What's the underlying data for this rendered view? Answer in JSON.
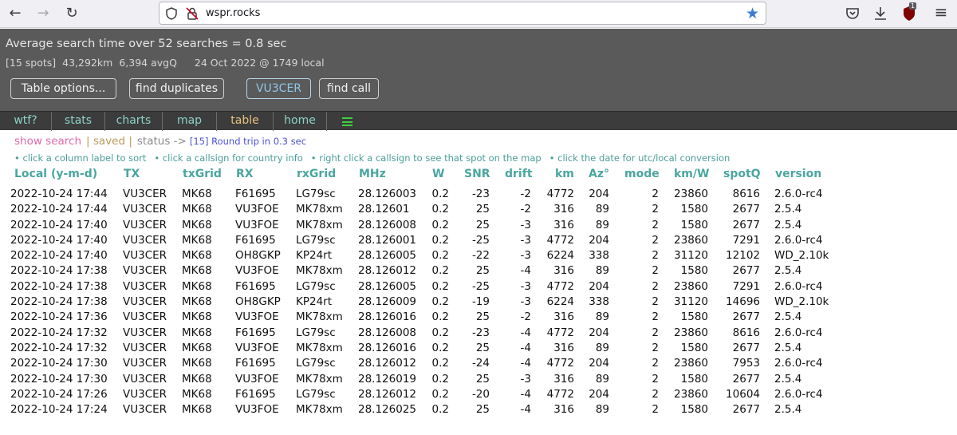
{
  "browser": {
    "url": "wspr.rocks",
    "badge_count": "1"
  },
  "header": {
    "avg_line": "Average search time over 52 searches = 0.8 sec",
    "spots": "[15 spots]",
    "distance": "43,292km",
    "avgq": "6,394 avgQ",
    "datetime": "24 Oct 2022 @ 1749 local"
  },
  "buttons": {
    "table_options": "Table options...",
    "find_duplicates": "find duplicates",
    "callsign": "VU3CER",
    "find_call": "find call"
  },
  "nav": {
    "wtf": "wtf?",
    "stats": "stats",
    "charts": "charts",
    "map": "map",
    "table": "table",
    "home": "home"
  },
  "status": {
    "show_search": "show search",
    "saved": "| saved |",
    "status": "status ->",
    "round_trip": "[15] Round trip in 0.3 sec"
  },
  "hints": [
    "• click a column label to sort",
    "• click a callsign for country info",
    "• right click a callsign to see that spot on the map",
    "• click the date for utc/local conversion"
  ],
  "columns": [
    "Local   (y-m-d)",
    "TX",
    "txGrid",
    "RX",
    "rxGrid",
    "MHz",
    "W",
    "SNR",
    "drift",
    "km",
    "Az°",
    "mode",
    "km/W",
    "spotQ",
    "version"
  ],
  "rows": [
    [
      "2022-10-24 17:44",
      "VU3CER",
      "MK68",
      "F61695",
      "LG79sc",
      "28.126003",
      "0.2",
      "-23",
      "-2",
      "4772",
      "204",
      "2",
      "23860",
      "8616",
      "2.6.0-rc4"
    ],
    [
      "2022-10-24 17:44",
      "VU3CER",
      "MK68",
      "VU3FOE",
      "MK78xm",
      "28.12601",
      "0.2",
      "25",
      "-2",
      "316",
      "89",
      "2",
      "1580",
      "2677",
      "2.5.4"
    ],
    [
      "2022-10-24 17:40",
      "VU3CER",
      "MK68",
      "VU3FOE",
      "MK78xm",
      "28.126008",
      "0.2",
      "25",
      "-3",
      "316",
      "89",
      "2",
      "1580",
      "2677",
      "2.5.4"
    ],
    [
      "2022-10-24 17:40",
      "VU3CER",
      "MK68",
      "F61695",
      "LG79sc",
      "28.126001",
      "0.2",
      "-25",
      "-3",
      "4772",
      "204",
      "2",
      "23860",
      "7291",
      "2.6.0-rc4"
    ],
    [
      "2022-10-24 17:40",
      "VU3CER",
      "MK68",
      "OH8GKP",
      "KP24rt",
      "28.126005",
      "0.2",
      "-22",
      "-3",
      "6224",
      "338",
      "2",
      "31120",
      "12102",
      "WD_2.10k"
    ],
    [
      "2022-10-24 17:38",
      "VU3CER",
      "MK68",
      "VU3FOE",
      "MK78xm",
      "28.126012",
      "0.2",
      "25",
      "-4",
      "316",
      "89",
      "2",
      "1580",
      "2677",
      "2.5.4"
    ],
    [
      "2022-10-24 17:38",
      "VU3CER",
      "MK68",
      "F61695",
      "LG79sc",
      "28.126005",
      "0.2",
      "-25",
      "-3",
      "4772",
      "204",
      "2",
      "23860",
      "7291",
      "2.6.0-rc4"
    ],
    [
      "2022-10-24 17:38",
      "VU3CER",
      "MK68",
      "OH8GKP",
      "KP24rt",
      "28.126009",
      "0.2",
      "-19",
      "-3",
      "6224",
      "338",
      "2",
      "31120",
      "14696",
      "WD_2.10k"
    ],
    [
      "2022-10-24 17:36",
      "VU3CER",
      "MK68",
      "VU3FOE",
      "MK78xm",
      "28.126016",
      "0.2",
      "25",
      "-2",
      "316",
      "89",
      "2",
      "1580",
      "2677",
      "2.5.4"
    ],
    [
      "2022-10-24 17:32",
      "VU3CER",
      "MK68",
      "F61695",
      "LG79sc",
      "28.126008",
      "0.2",
      "-23",
      "-4",
      "4772",
      "204",
      "2",
      "23860",
      "8616",
      "2.6.0-rc4"
    ],
    [
      "2022-10-24 17:32",
      "VU3CER",
      "MK68",
      "VU3FOE",
      "MK78xm",
      "28.126016",
      "0.2",
      "25",
      "-4",
      "316",
      "89",
      "2",
      "1580",
      "2677",
      "2.5.4"
    ],
    [
      "2022-10-24 17:30",
      "VU3CER",
      "MK68",
      "F61695",
      "LG79sc",
      "28.126012",
      "0.2",
      "-24",
      "-4",
      "4772",
      "204",
      "2",
      "23860",
      "7953",
      "2.6.0-rc4"
    ],
    [
      "2022-10-24 17:30",
      "VU3CER",
      "MK68",
      "VU3FOE",
      "MK78xm",
      "28.126019",
      "0.2",
      "25",
      "-3",
      "316",
      "89",
      "2",
      "1580",
      "2677",
      "2.5.4"
    ],
    [
      "2022-10-24 17:26",
      "VU3CER",
      "MK68",
      "F61695",
      "LG79sc",
      "28.126012",
      "0.2",
      "-20",
      "-4",
      "4772",
      "204",
      "2",
      "23860",
      "10604",
      "2.6.0-rc4"
    ],
    [
      "2022-10-24 17:24",
      "VU3CER",
      "MK68",
      "VU3FOE",
      "MK78xm",
      "28.126025",
      "0.2",
      "25",
      "-4",
      "316",
      "89",
      "2",
      "1580",
      "2677",
      "2.5.4"
    ]
  ]
}
